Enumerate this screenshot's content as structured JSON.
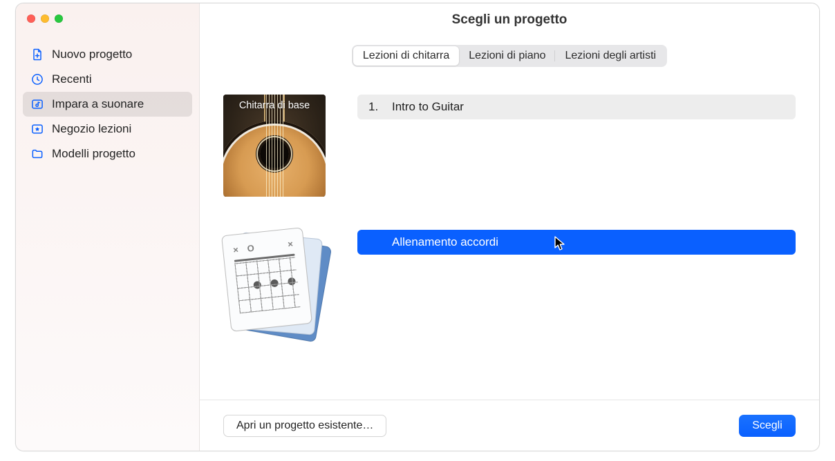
{
  "window": {
    "title": "Scegli un progetto"
  },
  "sidebar": {
    "items": [
      {
        "label": "Nuovo progetto"
      },
      {
        "label": "Recenti"
      },
      {
        "label": "Impara a suonare"
      },
      {
        "label": "Negozio lezioni"
      },
      {
        "label": "Modelli progetto"
      }
    ],
    "selected_index": 2
  },
  "segmented": {
    "tabs": [
      {
        "label": "Lezioni di chitarra"
      },
      {
        "label": "Lezioni di piano"
      },
      {
        "label": "Lezioni degli artisti"
      }
    ],
    "active_index": 0
  },
  "groups": [
    {
      "thumb_title": "Chitarra di base",
      "thumb_kind": "guitar",
      "rows": [
        {
          "num": "1.",
          "title": "Intro to Guitar",
          "selected": false
        }
      ]
    },
    {
      "thumb_title": "",
      "thumb_kind": "chord",
      "rows": [
        {
          "num": "",
          "title": "Allenamento accordi",
          "selected": true
        }
      ]
    }
  ],
  "footer": {
    "open_existing": "Apri un progetto esistente…",
    "choose": "Scegli"
  }
}
